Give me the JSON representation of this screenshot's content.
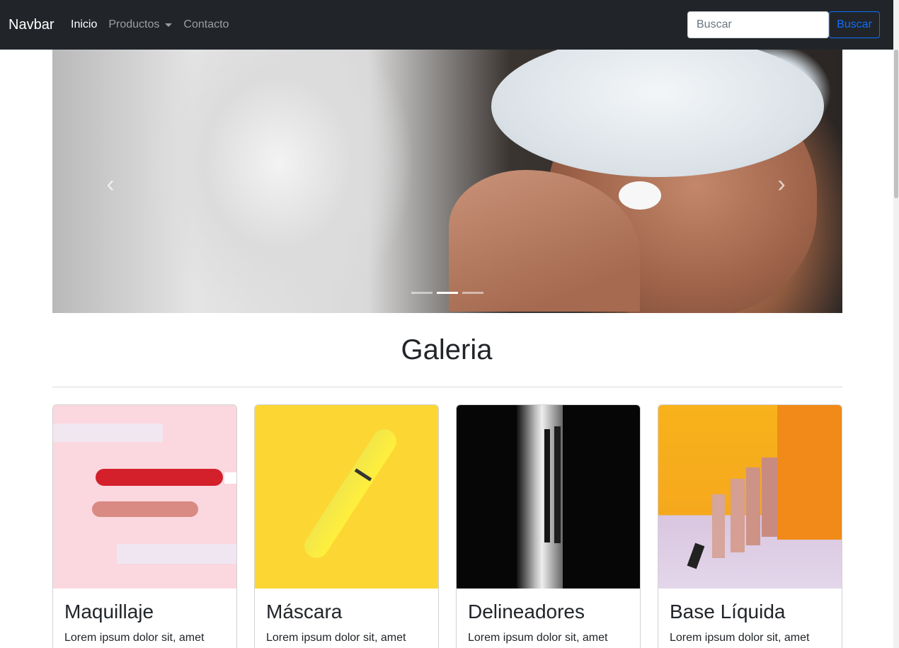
{
  "navbar": {
    "brand": "Navbar",
    "links": [
      {
        "label": "Inicio",
        "active": true
      },
      {
        "label": "Productos",
        "dropdown": true
      },
      {
        "label": "Contacto"
      }
    ],
    "search_placeholder": "Buscar",
    "search_button": "Buscar"
  },
  "carousel": {
    "slide_count": 3,
    "active_slide": 2,
    "prev_icon": "chevron-left-icon",
    "next_icon": "chevron-right-icon"
  },
  "gallery": {
    "title": "Galeria",
    "cards": [
      {
        "title": "Maquillaje",
        "text": "Lorem ipsum dolor sit, amet"
      },
      {
        "title": "Máscara",
        "text": "Lorem ipsum dolor sit, amet"
      },
      {
        "title": "Delineadores",
        "text": "Lorem ipsum dolor sit, amet"
      },
      {
        "title": "Base Líquida",
        "text": "Lorem ipsum dolor sit, amet"
      }
    ]
  },
  "colors": {
    "navbar_bg": "#212529",
    "accent": "#0d6efd"
  }
}
